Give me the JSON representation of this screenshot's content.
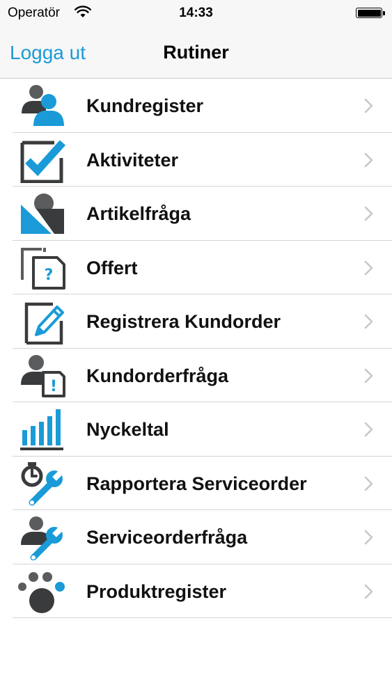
{
  "status_bar": {
    "carrier": "Operatör",
    "time": "14:33"
  },
  "nav": {
    "back_label": "Logga ut",
    "title": "Rutiner"
  },
  "colors": {
    "accent": "#1a9bd7",
    "icon_gray": "#5b5c5e",
    "icon_dark": "#3a3b3d"
  },
  "menu": {
    "items": [
      {
        "label": "Kundregister",
        "icon": "customers-icon"
      },
      {
        "label": "Aktiviteter",
        "icon": "checkbox-icon"
      },
      {
        "label": "Artikelfråga",
        "icon": "article-query-icon"
      },
      {
        "label": "Offert",
        "icon": "quote-document-icon"
      },
      {
        "label": "Registrera Kundorder",
        "icon": "edit-document-icon"
      },
      {
        "label": "Kundorderfråga",
        "icon": "customer-order-query-icon"
      },
      {
        "label": "Nyckeltal",
        "icon": "bar-chart-icon"
      },
      {
        "label": "Rapportera Serviceorder",
        "icon": "timer-wrench-icon"
      },
      {
        "label": "Serviceorderfråga",
        "icon": "person-wrench-icon"
      },
      {
        "label": "Produktregister",
        "icon": "paw-icon"
      }
    ]
  }
}
